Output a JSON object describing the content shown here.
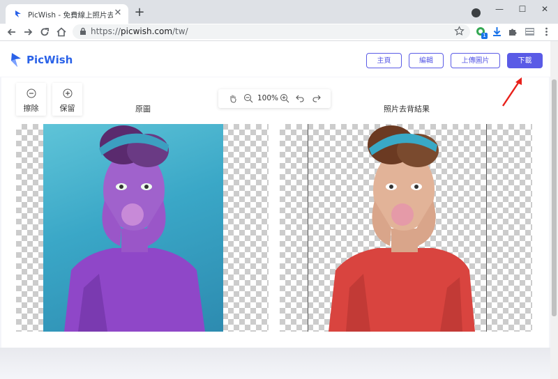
{
  "browser": {
    "tab_title": "PicWish - 免費線上照片去背 | 線",
    "url_prefix": "https://",
    "url_host": "picwish.com",
    "url_path": "/tw/",
    "ext_badge": "1"
  },
  "brand": {
    "name": "PicWish",
    "accent": "#5a5be6",
    "logo_color": "#2a62e8"
  },
  "nav": {
    "home": "主頁",
    "edit": "編輯",
    "upload": "上傳圖片",
    "download": "下載"
  },
  "tools": {
    "erase": "擦除",
    "keep": "保留"
  },
  "zoom": {
    "value": "100%"
  },
  "panels": {
    "original": "原圖",
    "result": "照片去背結果"
  },
  "annotation": {
    "arrow_color": "#e8201a"
  }
}
